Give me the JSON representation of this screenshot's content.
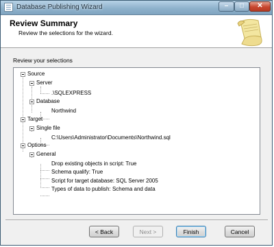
{
  "window": {
    "title": "Database Publishing Wizard"
  },
  "header": {
    "title": "Review Summary",
    "subtitle": "Review the selections for the wizard."
  },
  "review_label": "Review your selections",
  "tree": {
    "source": "Source",
    "server": "Server",
    "server_value": ".\\SQLEXPRESS",
    "database": "Database",
    "database_value": "Northwind",
    "target": "Target",
    "single_file": "Single file",
    "file_path": "C:\\Users\\Administrator\\Documents\\Northwind.sql",
    "options": "Options",
    "general": "General",
    "option_items": [
      "Drop existing objects in script: True",
      "Schema qualify: True",
      "Script for target database: SQL Server 2005",
      "Types of data to publish: Schema and data"
    ]
  },
  "buttons": {
    "back": "< Back",
    "next": "Next >",
    "finish": "Finish",
    "cancel": "Cancel"
  }
}
